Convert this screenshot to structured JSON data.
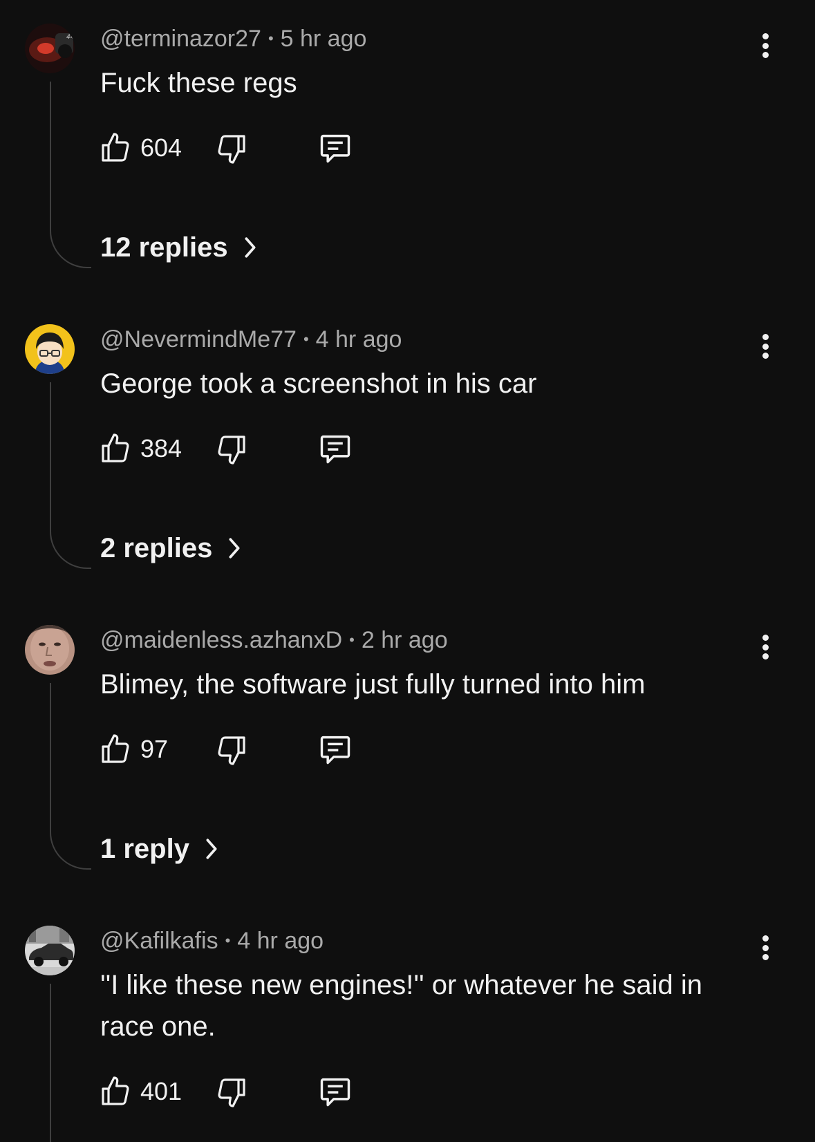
{
  "comments": [
    {
      "author": "@terminazor27",
      "time": "5 hr ago",
      "text": "Fuck these regs",
      "likes": "604",
      "replies": "12 replies",
      "avatar_icon": "race-car-avatar",
      "avatar_colors": [
        "#2a1212",
        "#d23a2a"
      ]
    },
    {
      "author": "@NevermindMe77",
      "time": "4 hr ago",
      "text": "George took a screenshot in his car",
      "likes": "384",
      "replies": "2 replies",
      "avatar_icon": "cartoon-character-avatar",
      "avatar_colors": [
        "#f2c21b",
        "#1e3f8a"
      ]
    },
    {
      "author": "@maidenless.azhanxD",
      "time": "2 hr ago",
      "text": "Blimey, the software just fully turned into him",
      "likes": "97",
      "replies": "1 reply",
      "avatar_icon": "face-photo-avatar",
      "avatar_colors": [
        "#c9a393",
        "#8a6a5c"
      ]
    },
    {
      "author": "@Kafilkafis",
      "time": "4 hr ago",
      "text": "''I like these new engines!'' or whatever he said in race one.",
      "likes": "401",
      "avatar_icon": "car-photo-avatar",
      "avatar_colors": [
        "#d9d9d9",
        "#2b2b2b"
      ]
    }
  ],
  "icons": {
    "like": "thumbs-up-icon",
    "dislike": "thumbs-down-icon",
    "reply": "comment-icon",
    "more": "more-vertical-icon",
    "expand": "chevron-right-icon"
  },
  "colors": {
    "background": "#0f0f0f",
    "text": "#f1f1f1",
    "meta": "#aaaaaa",
    "thread_line": "#3f3f3f"
  }
}
